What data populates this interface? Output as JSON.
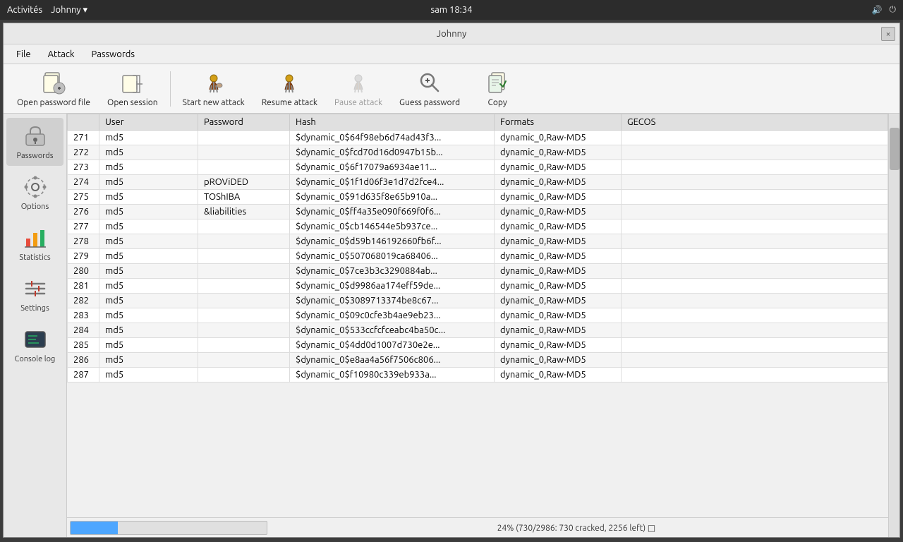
{
  "system_bar": {
    "activities": "Activités",
    "app_name": "Johnny ▾",
    "time": "sam 18:34"
  },
  "window": {
    "title": "Johnny",
    "close_label": "×"
  },
  "menu": {
    "items": [
      "File",
      "Attack",
      "Passwords"
    ]
  },
  "toolbar": {
    "open_password_file_label": "Open password file",
    "open_session_label": "Open session",
    "start_new_attack_label": "Start new attack",
    "resume_attack_label": "Resume attack",
    "pause_attack_label": "Pause attack",
    "guess_password_label": "Guess password",
    "copy_label": "Copy"
  },
  "sidebar": {
    "items": [
      {
        "label": "Passwords",
        "icon": "🔒"
      },
      {
        "label": "Options",
        "icon": "⚙"
      },
      {
        "label": "Statistics",
        "icon": "📊"
      },
      {
        "label": "Settings",
        "icon": "🔧"
      },
      {
        "label": "Console log",
        "icon": "🖥"
      }
    ]
  },
  "table": {
    "columns": [
      "",
      "User",
      "Password",
      "Hash",
      "Formats",
      "GECOS"
    ],
    "rows": [
      {
        "num": "271",
        "user": "md5",
        "pass": "",
        "hash": "$dynamic_0$64f98eb6d74ad43f3...",
        "fmt": "dynamic_0,Raw-MD5",
        "gecos": ""
      },
      {
        "num": "272",
        "user": "md5",
        "pass": "",
        "hash": "$dynamic_0$fcd70d16d0947b15b...",
        "fmt": "dynamic_0,Raw-MD5",
        "gecos": ""
      },
      {
        "num": "273",
        "user": "md5",
        "pass": "",
        "hash": "$dynamic_0$6f17079a6934ae11...",
        "fmt": "dynamic_0,Raw-MD5",
        "gecos": ""
      },
      {
        "num": "274",
        "user": "md5",
        "pass": "pROViDED",
        "hash": "$dynamic_0$1f1d06f3e1d7d2fce4...",
        "fmt": "dynamic_0,Raw-MD5",
        "gecos": ""
      },
      {
        "num": "275",
        "user": "md5",
        "pass": "TOShIBA",
        "hash": "$dynamic_0$91d635f8e65b910a...",
        "fmt": "dynamic_0,Raw-MD5",
        "gecos": ""
      },
      {
        "num": "276",
        "user": "md5",
        "pass": "&liabilities",
        "hash": "$dynamic_0$ff4a35e090f669f0f6...",
        "fmt": "dynamic_0,Raw-MD5",
        "gecos": ""
      },
      {
        "num": "277",
        "user": "md5",
        "pass": "",
        "hash": "$dynamic_0$cb146544e5b937ce...",
        "fmt": "dynamic_0,Raw-MD5",
        "gecos": ""
      },
      {
        "num": "278",
        "user": "md5",
        "pass": "",
        "hash": "$dynamic_0$d59b146192660fb6f...",
        "fmt": "dynamic_0,Raw-MD5",
        "gecos": ""
      },
      {
        "num": "279",
        "user": "md5",
        "pass": "",
        "hash": "$dynamic_0$507068019ca68406...",
        "fmt": "dynamic_0,Raw-MD5",
        "gecos": ""
      },
      {
        "num": "280",
        "user": "md5",
        "pass": "",
        "hash": "$dynamic_0$7ce3b3c3290884ab...",
        "fmt": "dynamic_0,Raw-MD5",
        "gecos": ""
      },
      {
        "num": "281",
        "user": "md5",
        "pass": "",
        "hash": "$dynamic_0$d9986aa174eff59de...",
        "fmt": "dynamic_0,Raw-MD5",
        "gecos": ""
      },
      {
        "num": "282",
        "user": "md5",
        "pass": "",
        "hash": "$dynamic_0$3089713374be8c67...",
        "fmt": "dynamic_0,Raw-MD5",
        "gecos": ""
      },
      {
        "num": "283",
        "user": "md5",
        "pass": "",
        "hash": "$dynamic_0$09c0cfe3b4ae9eb23...",
        "fmt": "dynamic_0,Raw-MD5",
        "gecos": ""
      },
      {
        "num": "284",
        "user": "md5",
        "pass": "",
        "hash": "$dynamic_0$533ccfcfceabc4ba50c...",
        "fmt": "dynamic_0,Raw-MD5",
        "gecos": ""
      },
      {
        "num": "285",
        "user": "md5",
        "pass": "",
        "hash": "$dynamic_0$4dd0d1007d730e2e...",
        "fmt": "dynamic_0,Raw-MD5",
        "gecos": ""
      },
      {
        "num": "286",
        "user": "md5",
        "pass": "",
        "hash": "$dynamic_0$e8aa4a56f7506c806...",
        "fmt": "dynamic_0,Raw-MD5",
        "gecos": ""
      },
      {
        "num": "287",
        "user": "md5",
        "pass": "",
        "hash": "$dynamic_0$f10980c339eb933a...",
        "fmt": "dynamic_0,Raw-MD5",
        "gecos": ""
      }
    ]
  },
  "status": {
    "progress_percent": 24,
    "text": "24% (730/2986: 730 cracked, 2256 left) □"
  }
}
